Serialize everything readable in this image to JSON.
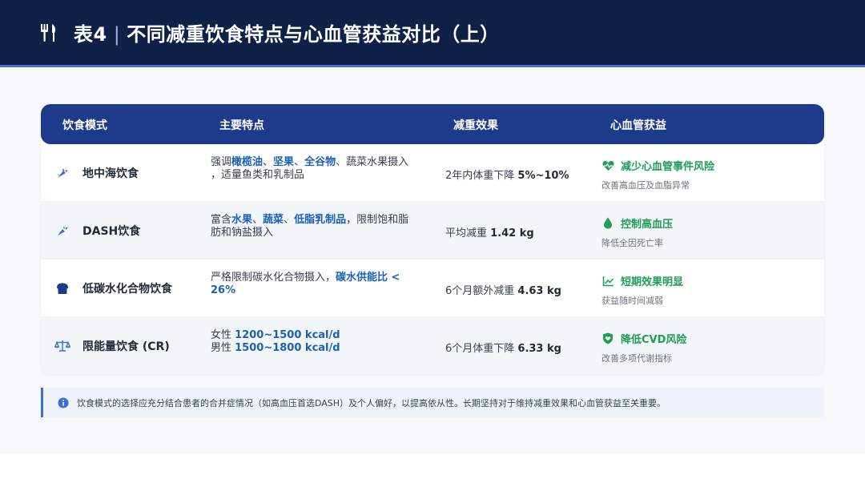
{
  "header": {
    "icon": "utensils-icon",
    "label": "表4",
    "separator": "|",
    "title": "不同减重饮食特点与心血管获益对比（上）"
  },
  "table": {
    "columns": [
      "饮食模式",
      "主要特点",
      "减重效果",
      "心血管获益"
    ],
    "rows": [
      {
        "icon": "fish-icon",
        "name": "地中海饮食",
        "features_line1": [
          "强调",
          "橄榄油",
          "、",
          "坚果",
          "、",
          "全谷物",
          "、蔬菜水果摄入"
        ],
        "features_line2": "，适量鱼类和乳制品",
        "effect_prefix": "2年内体重下降 ",
        "effect_value": "5%~10%",
        "benefit_icon": "heart-pulse-icon",
        "benefit": "减少心血管事件风险",
        "benefit_sub": "改善高血压及血脂异常"
      },
      {
        "icon": "carrot-icon",
        "name": "DASH饮食",
        "features_line1": [
          "富含",
          "水果",
          "、",
          "蔬菜",
          "、",
          "低脂乳制品",
          "，限制饱和脂"
        ],
        "features_line2": "肪和钠盐摄入",
        "effect_prefix": "平均减重 ",
        "effect_value": "1.42 kg",
        "benefit_icon": "droplet-icon",
        "benefit": "控制高血压",
        "benefit_sub": "降低全因死亡率"
      },
      {
        "icon": "bread-icon",
        "name": "低碳水化合物饮食",
        "features_line1": [
          "严格限制碳水化合物摄入，",
          "碳水供能比 <"
        ],
        "features_line2": "26%",
        "effect_prefix": "6个月额外减重 ",
        "effect_value": "4.63 kg",
        "benefit_icon": "chart-line-icon",
        "benefit": "短期效果明显",
        "benefit_sub": "获益随时间减弱"
      },
      {
        "icon": "scale-icon",
        "name": "限能量饮食 (CR)",
        "features_line1": [
          "女性 ",
          "1200~1500 kcal/d"
        ],
        "features_line2": [
          "男性 ",
          "1500~1800 kcal/d"
        ],
        "effect_prefix": "6个月体重下降 ",
        "effect_value": "6.33 kg",
        "benefit_icon": "shield-heart-icon",
        "benefit": "降低CVD风险",
        "benefit_sub": "改善多项代谢指标"
      }
    ]
  },
  "note": {
    "icon": "info-icon",
    "text": "饮食模式的选择应充分结合患者的合并症情况（如高血压首选DASH）及个人偏好，以提高依从性。长期坚持对于维持减重效果和心血管获益至关重要。"
  },
  "colors": {
    "header_bg": "#0f2147",
    "table_head_bg": "#1e3a8a",
    "highlight": "#1d5fb8",
    "benefit_green": "#1f9d55"
  }
}
